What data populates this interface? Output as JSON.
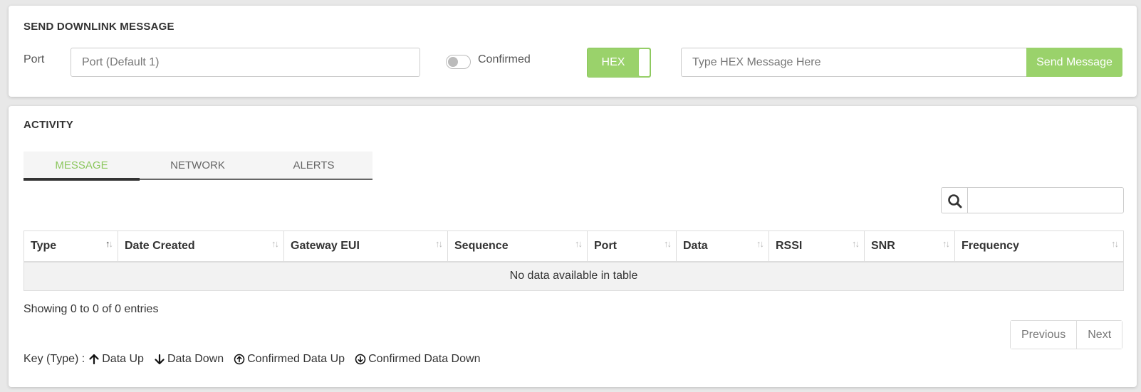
{
  "downlink": {
    "title": "SEND DOWNLINK MESSAGE",
    "port_label": "Port",
    "port_placeholder": "Port (Default 1)",
    "confirmed_label": "Confirmed",
    "confirmed_on": false,
    "format_label": "HEX",
    "message_placeholder": "Type HEX Message Here",
    "send_label": "Send Message"
  },
  "activity": {
    "title": "ACTIVITY",
    "tabs": [
      {
        "label": "MESSAGE",
        "active": true
      },
      {
        "label": "NETWORK",
        "active": false
      },
      {
        "label": "ALERTS",
        "active": false
      }
    ],
    "search_icon": "search-icon",
    "columns": [
      "Type",
      "Date Created",
      "Gateway EUI",
      "Sequence",
      "Port",
      "Data",
      "RSSI",
      "SNR",
      "Frequency"
    ],
    "empty_message": "No data available in table",
    "info_text": "Showing 0 to 0 of 0 entries",
    "pagination": {
      "previous": "Previous",
      "next": "Next"
    },
    "key": {
      "label": "Key (Type) :",
      "items": [
        {
          "icon": "arrow-up-icon",
          "label": "Data Up"
        },
        {
          "icon": "arrow-down-icon",
          "label": "Data Down"
        },
        {
          "icon": "circle-arrow-up-icon",
          "label": "Confirmed Data Up"
        },
        {
          "icon": "circle-arrow-down-icon",
          "label": "Confirmed Data Down"
        }
      ]
    }
  },
  "colors": {
    "accent": "#9ad26b",
    "tab_active_text": "#8cc75e"
  }
}
